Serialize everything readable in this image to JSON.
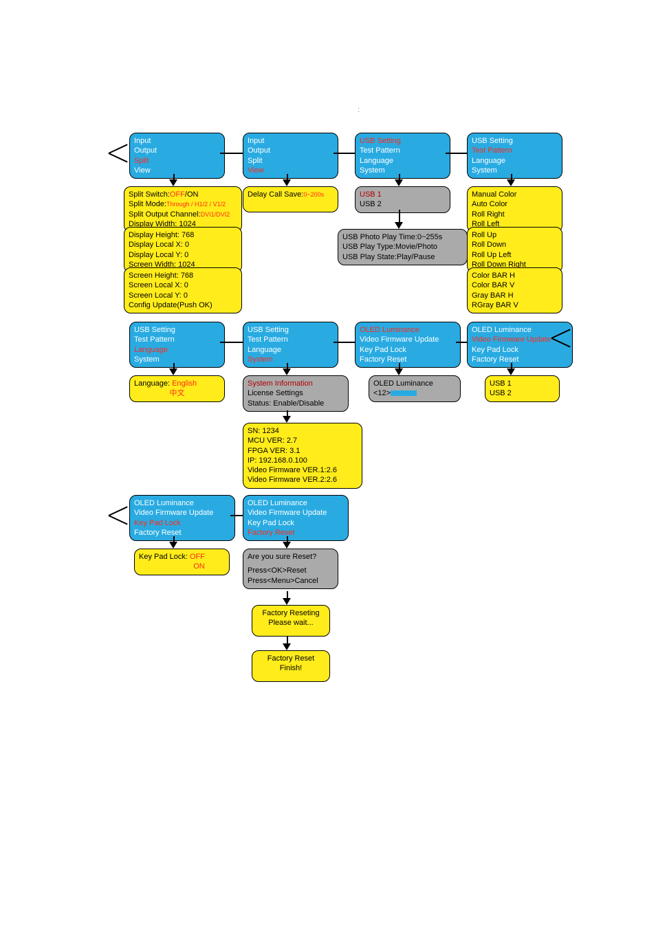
{
  "page_title": ":",
  "row1": {
    "b1": {
      "l1": "Input",
      "l2": "Output",
      "l3": "Split",
      "l4": "View"
    },
    "b2": {
      "l1": "Input",
      "l2": "Output",
      "l3": "Split",
      "l4": "View"
    },
    "b3": {
      "l1": "USB Setting",
      "l2": "Test Pattern",
      "l3": "Language",
      "l4": "System"
    },
    "b4": {
      "l1": "USB Setting",
      "l2": "Test Pattern",
      "l3": "Language",
      "l4": "System"
    }
  },
  "row1sub": {
    "c1a": "Split Switch:",
    "c1a_off": "OFF",
    "c1a_on": "/ON",
    "c1b": "Split Mode:",
    "c1b_v": "Through / H1/2 / V1/2",
    "c1c": "Split Output Channel:",
    "c1c_v": "DVI1/DVI2",
    "c1d": "Display Width: 1024",
    "c1e": "Display Height: 768",
    "c1f": "Display Local X:   0",
    "c1g": "Display Local Y:   0",
    "c1h": "Screen Width: 1024",
    "c1i": "Screen Height: 768",
    "c1j": "Screen Local X:   0",
    "c1k": "Screen Local Y:   0",
    "c1l": "Config Update(Push OK)",
    "c2": "Delay Call Save:",
    "c2_v": "0~200s",
    "c3a": "USB 1",
    "c3b": "USB 2",
    "c3sub1": "USB Photo Play Time:0~255s",
    "c3sub2": "USB Play Type:Movie/Photo",
    "c3sub3": "USB Play State:Play/Pause",
    "c4a": "Manual Color",
    "c4b": "Auto Color",
    "c4c": "Roll Right",
    "c4d": "Roll Left",
    "c4e": "Roll Up",
    "c4f": "Roll Down",
    "c4g": "Roll Up Left",
    "c4h": "Roll Down Right",
    "c4i": "Color BAR H",
    "c4j": "Color BAR V",
    "c4k": "Gray BAR H",
    "c4l": "RGray BAR V"
  },
  "row2": {
    "b1": {
      "l1": "USB Setting",
      "l2": "Test Pattern",
      "l3": "Language",
      "l4": "System"
    },
    "b2": {
      "l1": "USB Setting",
      "l2": "Test Pattern",
      "l3": "Language",
      "l4": "System"
    },
    "b3": {
      "l1": "OLED Luminance",
      "l2": "Video Firmware Update",
      "l3": "Key Pad Lock",
      "l4": "Factory Reset"
    },
    "b4": {
      "l1": "OLED Luminance",
      "l2": "Video Firmware Update",
      "l3": "Key Pad Lock",
      "l4": "Factory Reset"
    }
  },
  "row2sub": {
    "lang_l": "Language: ",
    "lang_en": "English",
    "lang_cn": "中文",
    "sys1": "System Information",
    "sys2": "License Settings",
    "sys3": "Status:  Enable/Disable",
    "info1": "SN:            1234",
    "info2": "MCU VER:     2.7",
    "info3": "FPGA VER:    3.1",
    "info4": "IP: 192.168.0.100",
    "info5": "Video Firmware VER.1:2.6",
    "info6": "Video Firmware VER.2:2.6",
    "oled_l": "OLED Luminance",
    "oled_v": "<12>",
    "usb1": "USB 1",
    "usb2": "USB 2"
  },
  "row3": {
    "b1": {
      "l1": "OLED Luminance",
      "l2": "Video Firmware Update",
      "l3": "Key Pad Lock",
      "l4": "Factory Reset"
    },
    "b2": {
      "l1": "OLED Luminance",
      "l2": "Video Firmware Update",
      "l3": "Key Pad Lock",
      "l4": "Factory Reset"
    },
    "kpl_l": "Key Pad Lock: ",
    "kpl_off": "OFF",
    "kpl_on": "ON",
    "reset1": "Are you sure Reset?",
    "reset2": "Press<OK>Reset",
    "reset3": "Press<Menu>Cancel",
    "reseting1": "Factory Reseting",
    "reseting2": "Please wait...",
    "done1": "Factory Reset",
    "done2": "Finish!"
  }
}
